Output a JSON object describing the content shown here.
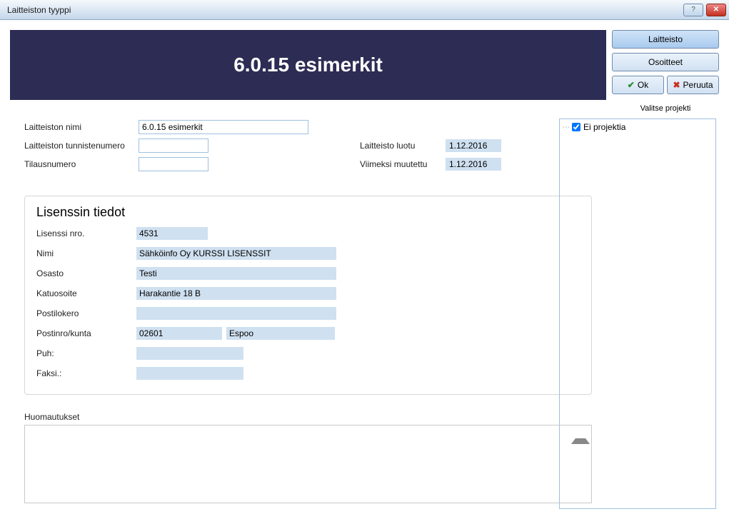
{
  "window": {
    "title": "Laitteiston tyyppi"
  },
  "banner": {
    "heading": "6.0.15 esimerkit"
  },
  "buttons": {
    "laitteisto": "Laitteisto",
    "osoitteet": "Osoitteet",
    "ok": "Ok",
    "cancel": "Peruuta"
  },
  "form": {
    "nimi_label": "Laitteiston nimi",
    "nimi_value": "6.0.15 esimerkit",
    "tunniste_label": "Laitteiston tunnistenumero",
    "tunniste_value": "",
    "tilaus_label": "Tilausnumero",
    "tilaus_value": "",
    "luotu_label": "Laitteisto luotu",
    "luotu_value": "1.12.2016",
    "muutettu_label": "Viimeksi muutettu",
    "muutettu_value": "1.12.2016"
  },
  "license": {
    "title": "Lisenssin tiedot",
    "nro_label": "Lisenssi nro.",
    "nro_value": "4531",
    "nimi_label": "Nimi",
    "nimi_value": "Sähköinfo Oy KURSSI LISENSSIT",
    "osasto_label": "Osasto",
    "osasto_value": "Testi",
    "katu_label": "Katuosoite",
    "katu_value": "Harakantie 18 B",
    "postilokero_label": "Postilokero",
    "postilokero_value": "",
    "postinro_label": "Postinro/kunta",
    "postinro_value": "02601",
    "kunta_value": "Espoo",
    "puh_label": "Puh:",
    "puh_value": "",
    "faksi_label": "Faksi.:",
    "faksi_value": ""
  },
  "notes": {
    "label": "Huomautukset"
  },
  "projects": {
    "label": "Valitse projekti",
    "none_label": "Ei projektia",
    "none_checked": true
  }
}
